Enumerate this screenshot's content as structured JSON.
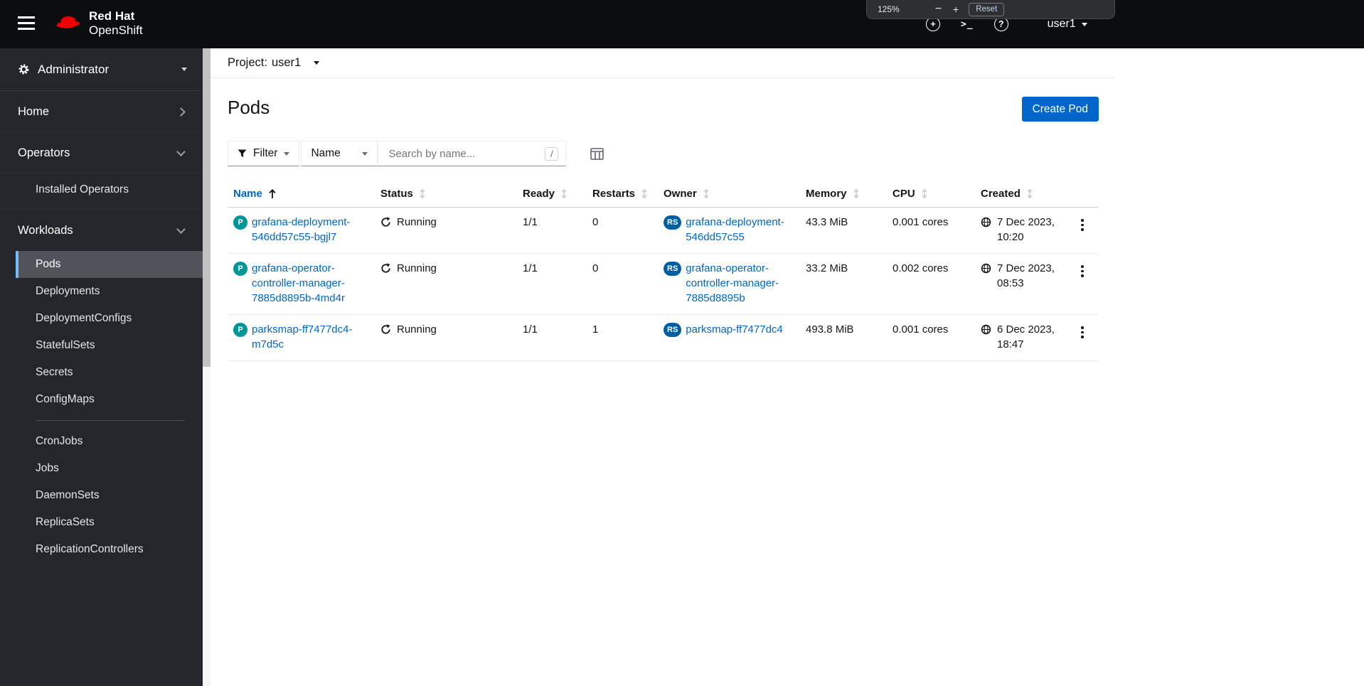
{
  "masthead": {
    "brand_line1": "Red Hat",
    "brand_line2": "OpenShift",
    "user": "user1"
  },
  "zoom_popup": {
    "level": "125%",
    "minus": "−",
    "plus": "+",
    "reset": "Reset"
  },
  "sidebar": {
    "perspective": "Administrator",
    "items": {
      "home": "Home",
      "operators": "Operators",
      "installed_operators": "Installed Operators",
      "workloads": "Workloads",
      "pods": "Pods",
      "deployments": "Deployments",
      "deploymentconfigs": "DeploymentConfigs",
      "statefulsets": "StatefulSets",
      "secrets": "Secrets",
      "configmaps": "ConfigMaps",
      "cronjobs": "CronJobs",
      "jobs": "Jobs",
      "daemonsets": "DaemonSets",
      "replicasets": "ReplicaSets",
      "replicationcontrollers": "ReplicationControllers"
    }
  },
  "project_bar": {
    "label": "Project:",
    "value": "user1"
  },
  "page": {
    "title": "Pods",
    "create_button": "Create Pod"
  },
  "toolbar": {
    "filter_label": "Filter",
    "attribute_selected": "Name",
    "search_placeholder": "Search by name...",
    "search_shortcut": "/"
  },
  "table": {
    "columns": [
      "Name",
      "Status",
      "Ready",
      "Restarts",
      "Owner",
      "Memory",
      "CPU",
      "Created"
    ],
    "sorted_column": "Name",
    "rows": [
      {
        "badge": "P",
        "name": "grafana-deployment-546dd57c55-bgjl7",
        "status": "Running",
        "ready": "1/1",
        "restarts": "0",
        "owner_badge": "RS",
        "owner": "grafana-deployment-546dd57c55",
        "memory": "43.3 MiB",
        "cpu": "0.001 cores",
        "created": "7 Dec 2023, 10:20"
      },
      {
        "badge": "P",
        "name": "grafana-operator-controller-manager-7885d8895b-4md4r",
        "status": "Running",
        "ready": "1/1",
        "restarts": "0",
        "owner_badge": "RS",
        "owner": "grafana-operator-controller-manager-7885d8895b",
        "memory": "33.2 MiB",
        "cpu": "0.002 cores",
        "created": "7 Dec 2023, 08:53"
      },
      {
        "badge": "P",
        "name": "parksmap-ff7477dc4-m7d5c",
        "status": "Running",
        "ready": "1/1",
        "restarts": "1",
        "owner_badge": "RS",
        "owner": "parksmap-ff7477dc4",
        "memory": "493.8 MiB",
        "cpu": "0.001 cores",
        "created": "6 Dec 2023, 18:47"
      }
    ]
  },
  "colors": {
    "accent": "#0066cc",
    "masthead_bg": "#0b0d0e",
    "sidebar_bg": "#23262a",
    "nav_active_bg": "#50545a",
    "nav_active_border": "#73bcf7",
    "pod_badge": "#009596",
    "replicaset_badge": "#005fa3",
    "brand_red": "#ee0000"
  }
}
